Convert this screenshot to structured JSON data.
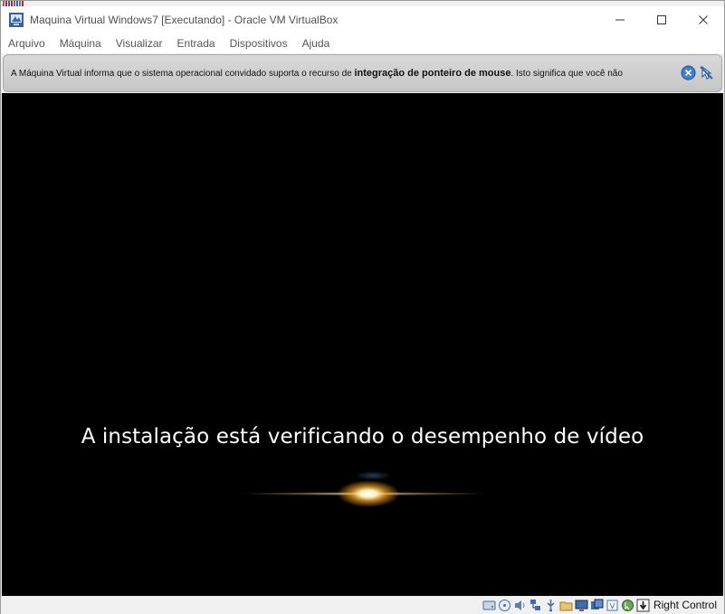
{
  "window": {
    "title": "Maquina Virtual Windows7 [Executando] - Oracle VM VirtualBox",
    "controls": {
      "minimize": "—",
      "maximize": "☐",
      "close": "✕"
    }
  },
  "menu": [
    "Arquivo",
    "Máquina",
    "Visualizar",
    "Entrada",
    "Dispositivos",
    "Ajuda"
  ],
  "notice": {
    "prefix": "A Máquina Virtual informa que o sistema operacional convidado suporta o recurso de ",
    "bold": "integração de ponteiro de mouse",
    "suffix": ". Isto significa que você não"
  },
  "screen": {
    "message": "A instalação está verificando o desempenho de vídeo"
  },
  "statusbar": {
    "icons": [
      "hard-disk-icon",
      "optical-drive-icon",
      "audio-icon",
      "network-icon",
      "usb-icon",
      "shared-folders-icon",
      "display-icon",
      "recording-icon",
      "virtualization-icon",
      "mouse-integration-icon",
      "keyboard-capture-icon"
    ],
    "host_key": "Right Control"
  }
}
